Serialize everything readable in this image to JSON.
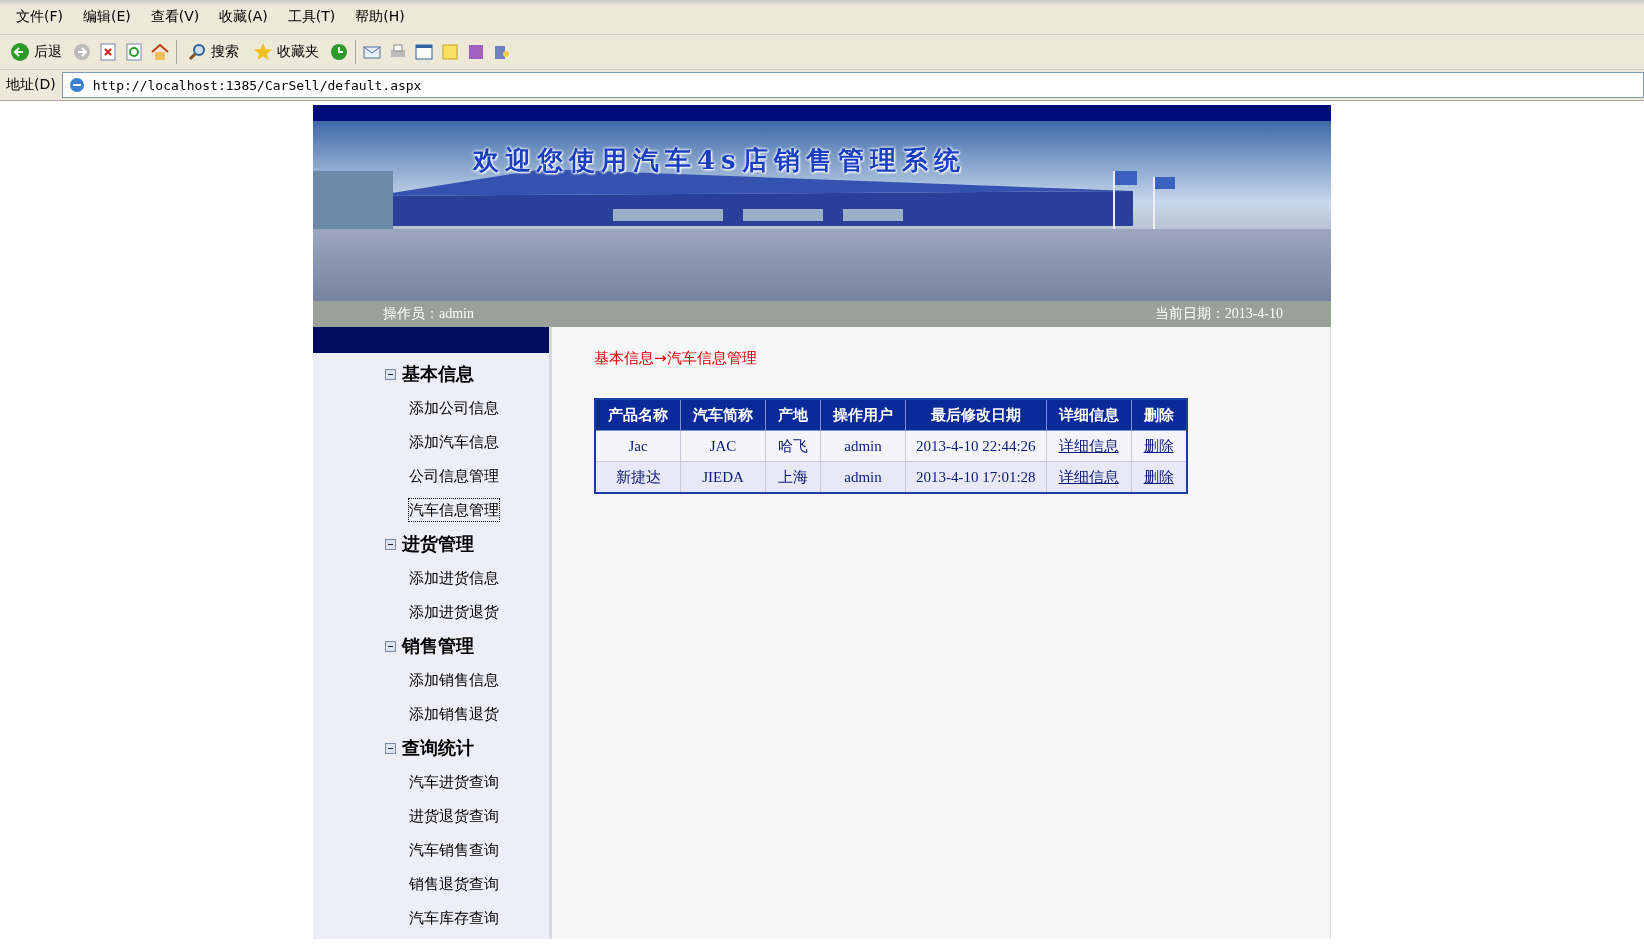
{
  "menu_bar": [
    "文件(F)",
    "编辑(E)",
    "查看(V)",
    "收藏(A)",
    "工具(T)",
    "帮助(H)"
  ],
  "toolbar": {
    "back": "后退",
    "search": "搜索",
    "favorites": "收藏夹"
  },
  "address_bar": {
    "label": "地址(D)",
    "url": "http://localhost:1385/CarSell/default.aspx"
  },
  "banner": {
    "title": "欢迎您使用汽车4s店销售管理系统"
  },
  "info_bar": {
    "operator": "操作员：admin",
    "date": "当前日期：2013-4-10"
  },
  "sidebar": {
    "groups": [
      {
        "title": "基本信息",
        "expanded": true,
        "children": [
          {
            "label": "添加公司信息",
            "selected": false
          },
          {
            "label": "添加汽车信息",
            "selected": false
          },
          {
            "label": "公司信息管理",
            "selected": false
          },
          {
            "label": "汽车信息管理",
            "selected": true
          }
        ]
      },
      {
        "title": "进货管理",
        "expanded": true,
        "children": [
          {
            "label": "添加进货信息",
            "selected": false
          },
          {
            "label": "添加进货退货",
            "selected": false
          }
        ]
      },
      {
        "title": "销售管理",
        "expanded": true,
        "children": [
          {
            "label": "添加销售信息",
            "selected": false
          },
          {
            "label": "添加销售退货",
            "selected": false
          }
        ]
      },
      {
        "title": "查询统计",
        "expanded": true,
        "children": [
          {
            "label": "汽车进货查询",
            "selected": false
          },
          {
            "label": "进货退货查询",
            "selected": false
          },
          {
            "label": "汽车销售查询",
            "selected": false
          },
          {
            "label": "销售退货查询",
            "selected": false
          },
          {
            "label": "汽车库存查询",
            "selected": false
          }
        ]
      }
    ]
  },
  "breadcrumb": "基本信息→汽车信息管理",
  "table": {
    "columns": [
      "产品名称",
      "汽车简称",
      "产地",
      "操作用户",
      "最后修改日期",
      "详细信息",
      "删除"
    ],
    "rows": [
      [
        "Jac",
        "JAC",
        "哈飞",
        "admin",
        "2013-4-10 22:44:26",
        "详细信息",
        "删除"
      ],
      [
        "新捷达",
        "JIEDA",
        "上海",
        "admin",
        "2013-4-10 17:01:28",
        "详细信息",
        "删除"
      ]
    ]
  }
}
